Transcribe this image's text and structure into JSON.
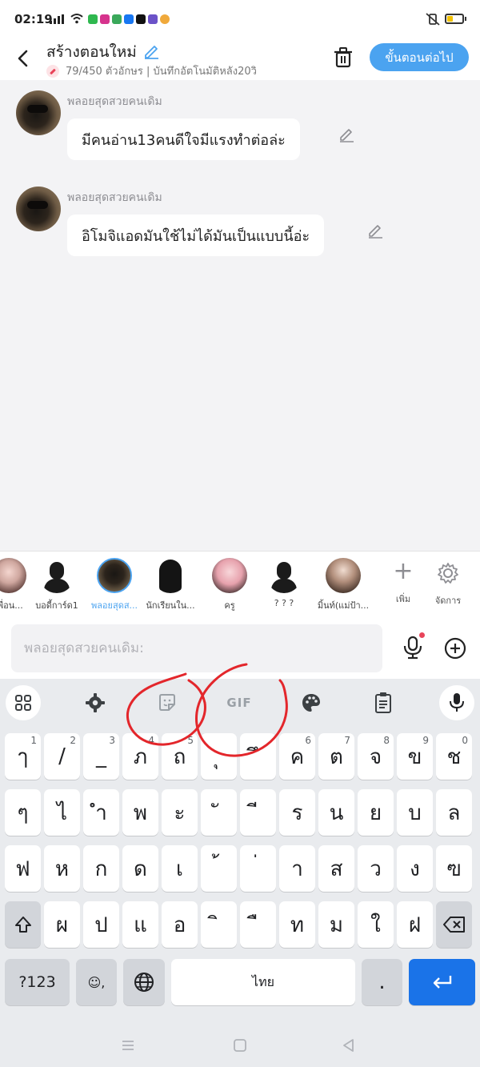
{
  "status": {
    "time": "02:19"
  },
  "header": {
    "title": "สร้างตอนใหม่",
    "meta": "79/450 ตัวอักษร | บันทึกอัตโนมัติหลัง20วิ",
    "next_label": "ขั้นตอนต่อไป"
  },
  "messages": [
    {
      "sender": "พลอยสุดสวยคนเดิม",
      "text": "มีคนอ่าน13คนดีใจมีแรงทำต่อล่ะ"
    },
    {
      "sender": "พลอยสุดสวยคนเดิม",
      "text": "อิโมจิแอดมันใช้ไม่ได้มันเป็นแบบนี้อ่ะ"
    }
  ],
  "characters": [
    {
      "label": "เพื่อน...",
      "style": "ph-girl"
    },
    {
      "label": "บอดี้การ์ด1",
      "style": "silhouette"
    },
    {
      "label": "พลอยสุดส...",
      "style": "ph-dark",
      "active": true
    },
    {
      "label": "นักเรียนใน...",
      "style": "ph-hood"
    },
    {
      "label": "ครู",
      "style": "ph-pink"
    },
    {
      "label": "? ? ?",
      "style": "silhouette"
    },
    {
      "label": "มิ้นท์(แม่ป้า...",
      "style": "ph-long"
    }
  ],
  "char_actions": {
    "add_label": "เพิ่ม",
    "manage_label": "จัดการ"
  },
  "composer": {
    "placeholder": "พลอยสุดสวยคนเดิม:"
  },
  "keyboard": {
    "toolbar": {
      "gif_label": "GIF"
    },
    "row1": [
      {
        "k": "ๅ",
        "h": "1"
      },
      {
        "k": "/",
        "h": "2"
      },
      {
        "k": "_",
        "h": "3"
      },
      {
        "k": "ภ",
        "h": "4"
      },
      {
        "k": "ถ",
        "h": "5"
      },
      {
        "k": "ุ",
        "h": ""
      },
      {
        "k": "ึ",
        "h": ""
      },
      {
        "k": "ค",
        "h": "6"
      },
      {
        "k": "ต",
        "h": "7"
      },
      {
        "k": "จ",
        "h": "8"
      },
      {
        "k": "ข",
        "h": "9"
      },
      {
        "k": "ช",
        "h": "0"
      }
    ],
    "row2": [
      "ๆ",
      "ไ",
      "ำ",
      "พ",
      "ะ",
      "ั",
      "ี",
      "ร",
      "น",
      "ย",
      "บ",
      "ล"
    ],
    "row3": [
      "ฟ",
      "ห",
      "ก",
      "ด",
      "เ",
      "้",
      "่",
      "า",
      "ส",
      "ว",
      "ง",
      "ฃ"
    ],
    "row4": [
      "ผ",
      "ป",
      "แ",
      "อ",
      "ิ",
      "ื",
      "ท",
      "ม",
      "ใ",
      "ฝ"
    ],
    "symbols_label": "?123",
    "emoji_comma_label": "☺,",
    "space_label": "ไทย",
    "period_label": "."
  },
  "colors": {
    "accent": "#4ba3f0",
    "enter": "#1a73e8",
    "annotation": "#e3262b"
  }
}
